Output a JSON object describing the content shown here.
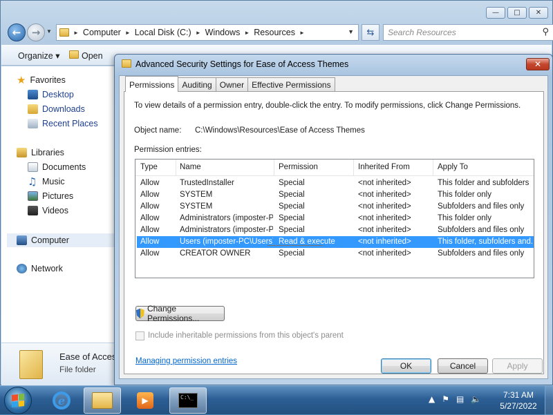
{
  "explorer": {
    "breadcrumbs": [
      "Computer",
      "Local Disk (C:)",
      "Windows",
      "Resources"
    ],
    "search_placeholder": "Search Resources",
    "toolbar": {
      "organize": "Organize",
      "open": "Open"
    },
    "sidebar": {
      "favorites": "Favorites",
      "desktop": "Desktop",
      "downloads": "Downloads",
      "recent_places": "Recent Places",
      "libraries": "Libraries",
      "documents": "Documents",
      "music": "Music",
      "pictures": "Pictures",
      "videos": "Videos",
      "computer": "Computer",
      "network": "Network"
    },
    "details": {
      "name": "Ease of Acces",
      "type": "File folder"
    }
  },
  "dialog": {
    "title": "Advanced Security Settings for Ease of Access Themes",
    "tabs": [
      "Permissions",
      "Auditing",
      "Owner",
      "Effective Permissions"
    ],
    "intro": "To view details of a permission entry, double-click the entry. To modify permissions, click Change Permissions.",
    "object_name_label": "Object name:",
    "object_name": "C:\\Windows\\Resources\\Ease of Access Themes",
    "entries_label": "Permission entries:",
    "columns": [
      "Type",
      "Name",
      "Permission",
      "Inherited From",
      "Apply To"
    ],
    "rows": [
      {
        "type": "Allow",
        "name": "TrustedInstaller",
        "permission": "Special",
        "inherited": "<not inherited>",
        "apply": "This folder and subfolders"
      },
      {
        "type": "Allow",
        "name": "SYSTEM",
        "permission": "Special",
        "inherited": "<not inherited>",
        "apply": "This folder only"
      },
      {
        "type": "Allow",
        "name": "SYSTEM",
        "permission": "Special",
        "inherited": "<not inherited>",
        "apply": "Subfolders and files only"
      },
      {
        "type": "Allow",
        "name": "Administrators (imposter-P...",
        "permission": "Special",
        "inherited": "<not inherited>",
        "apply": "This folder only"
      },
      {
        "type": "Allow",
        "name": "Administrators (imposter-P...",
        "permission": "Special",
        "inherited": "<not inherited>",
        "apply": "Subfolders and files only"
      },
      {
        "type": "Allow",
        "name": "Users (imposter-PC\\Users)",
        "permission": "Read & execute",
        "inherited": "<not inherited>",
        "apply": "This folder, subfolders and..."
      },
      {
        "type": "Allow",
        "name": "CREATOR OWNER",
        "permission": "Special",
        "inherited": "<not inherited>",
        "apply": "Subfolders and files only"
      }
    ],
    "selected_row": 5,
    "change_permissions": "Change Permissions...",
    "inherit_checkbox": "Include inheritable permissions from this object's parent",
    "inherit_checked": false,
    "link": "Managing permission entries",
    "ok": "OK",
    "cancel": "Cancel",
    "apply": "Apply"
  },
  "taskbar": {
    "time": "7:31 AM",
    "date": "5/27/2022",
    "cmd_icon_text": "C:\\_"
  },
  "colors": {
    "selection": "#3399ff",
    "link": "#0066cc",
    "close_button": "#c4462c"
  }
}
